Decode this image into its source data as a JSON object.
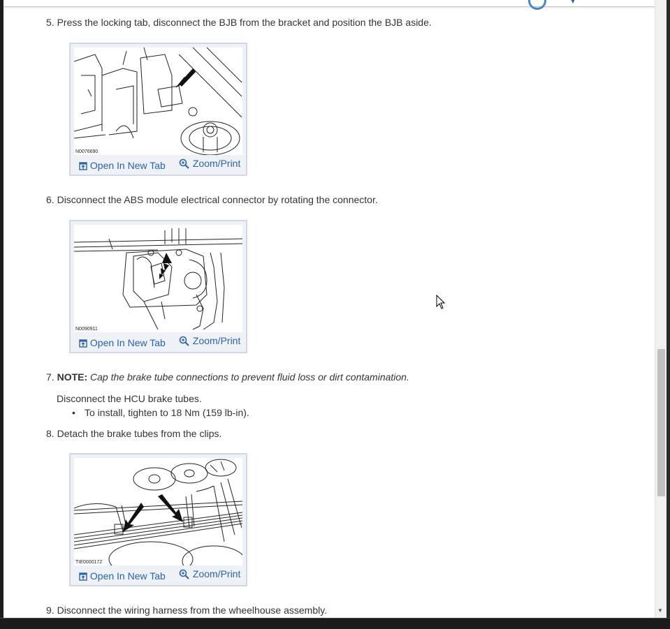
{
  "steps": [
    {
      "number": "5.",
      "text": "Press the locking tab, disconnect the BJB from the bracket and position the BJB aside."
    },
    {
      "number": "6.",
      "text": "Disconnect the ABS module electrical connector by rotating the connector."
    },
    {
      "number": "7.",
      "note_label": "NOTE:",
      "note_text": "Cap the brake tube connections to prevent fluid loss or dirt contamination.",
      "text": "Disconnect the HCU brake tubes.",
      "bullet": "To install, tighten to 18 Nm (159 lb-in)."
    },
    {
      "number": "8.",
      "text": "Detach the brake tubes from the clips."
    },
    {
      "number": "9.",
      "text": "Disconnect the wiring harness from the wheelhouse assembly."
    }
  ],
  "figures": [
    {
      "id": "N0076690"
    },
    {
      "id": "N0090911"
    },
    {
      "id": "TIE0000172"
    }
  ],
  "figure_actions": {
    "open_label": "Open In New Tab",
    "zoom_label": "Zoom/Print"
  },
  "icons": {
    "open": "open-new-tab-icon",
    "zoom": "zoom-magnifier-icon",
    "cursor": "mouse-pointer-icon"
  },
  "colors": {
    "link": "#2b62a6",
    "text": "#333333",
    "figure_bg": "#eef2f7",
    "scroll_thumb": "#c1c1c1"
  }
}
